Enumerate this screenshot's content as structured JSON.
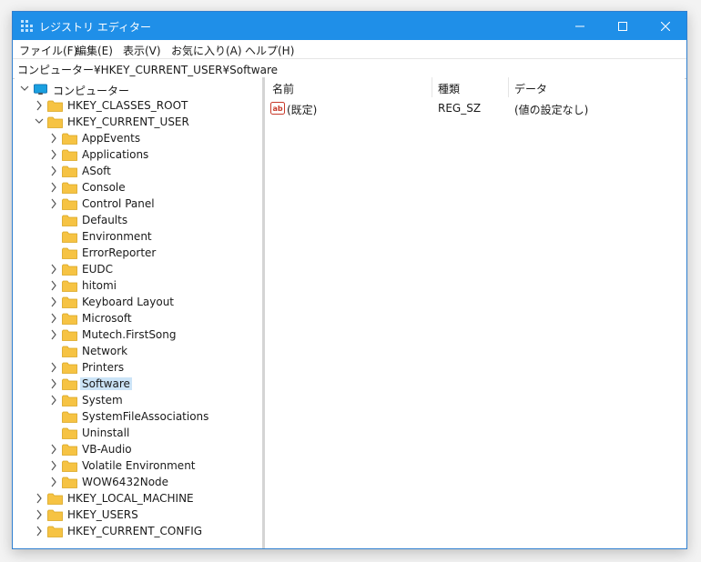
{
  "window": {
    "title": "レジストリ エディター"
  },
  "menu": [
    "ファイル(F)",
    "編集(E)",
    "表示(V)",
    "お気に入り(A)",
    "ヘルプ(H)"
  ],
  "address": "コンピューター¥HKEY_CURRENT_USER¥Software",
  "tree": {
    "root": "コンピューター",
    "hives": [
      "HKEY_CLASSES_ROOT",
      "HKEY_CURRENT_USER",
      "HKEY_LOCAL_MACHINE",
      "HKEY_USERS",
      "HKEY_CURRENT_CONFIG"
    ],
    "hkcu_children": [
      {
        "label": "AppEvents",
        "expandable": true
      },
      {
        "label": "Applications",
        "expandable": true
      },
      {
        "label": "ASoft",
        "expandable": true
      },
      {
        "label": "Console",
        "expandable": true
      },
      {
        "label": "Control Panel",
        "expandable": true
      },
      {
        "label": "Defaults",
        "expandable": false
      },
      {
        "label": "Environment",
        "expandable": false
      },
      {
        "label": "ErrorReporter",
        "expandable": false
      },
      {
        "label": "EUDC",
        "expandable": true
      },
      {
        "label": "hitomi",
        "expandable": true
      },
      {
        "label": "Keyboard Layout",
        "expandable": true
      },
      {
        "label": "Microsoft",
        "expandable": true
      },
      {
        "label": "Mutech.FirstSong",
        "expandable": true
      },
      {
        "label": "Network",
        "expandable": false
      },
      {
        "label": "Printers",
        "expandable": true
      },
      {
        "label": "Software",
        "expandable": true,
        "selected": true
      },
      {
        "label": "System",
        "expandable": true
      },
      {
        "label": "SystemFileAssociations",
        "expandable": false
      },
      {
        "label": "Uninstall",
        "expandable": false
      },
      {
        "label": "VB-Audio",
        "expandable": true
      },
      {
        "label": "Volatile Environment",
        "expandable": true
      },
      {
        "label": "WOW6432Node",
        "expandable": true
      }
    ]
  },
  "values": {
    "columns": [
      "名前",
      "種類",
      "データ"
    ],
    "rows": [
      {
        "name": "(既定)",
        "type": "REG_SZ",
        "data": "(値の設定なし)",
        "icon": "string-value-icon"
      }
    ]
  },
  "colors": {
    "titlebar": "#1f8fe8",
    "selection": "#cce4f7",
    "folder": "#f6c343"
  }
}
